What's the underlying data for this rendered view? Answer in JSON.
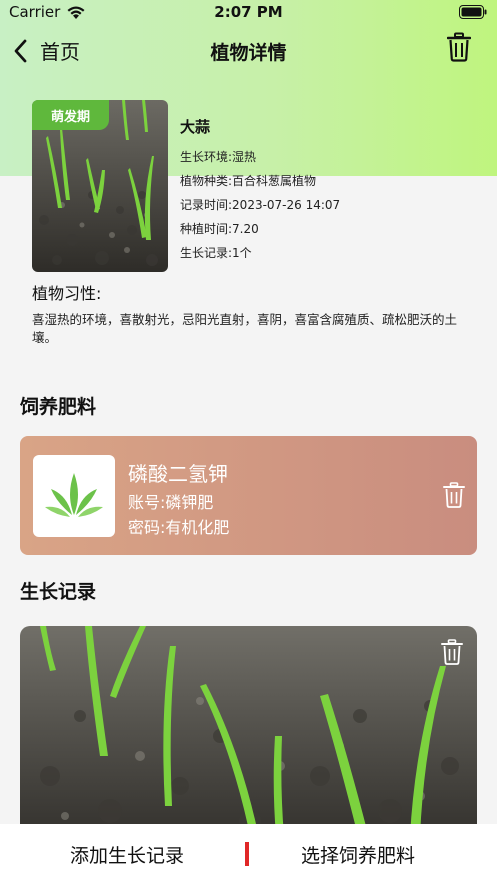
{
  "status_bar": {
    "carrier": "Carrier",
    "time": "2:07 PM"
  },
  "nav": {
    "back_label": "首页",
    "title": "植物详情"
  },
  "plant": {
    "stage": "萌发期",
    "name": "大蒜",
    "environment": "生长环境:湿热",
    "species": "植物种类:百合科葱属植物",
    "record_time": "记录时间:2023-07-26 14:07",
    "plant_time": "种植时间:7.20",
    "growth_count": "生长记录:1个",
    "habit_label": "植物习性:",
    "habit_text": "喜湿热的环境，喜散射光，忌阳光直射，喜阴，喜富含腐殖质、疏松肥沃的土壤。"
  },
  "fertilizer_section": {
    "title": "饲养肥料",
    "items": [
      {
        "name": "磷酸二氢钾",
        "account": "账号:磷钾肥",
        "password": "密码:有机化肥"
      }
    ]
  },
  "growth_section": {
    "title": "生长记录"
  },
  "bottom_bar": {
    "add_record": "添加生长记录",
    "select_fertilizer": "选择饲养肥料"
  },
  "colors": {
    "accent_green": "#5fb83c",
    "divider_red": "#e02727",
    "card_gradient_start": "#d9a486",
    "card_gradient_end": "#c98d7f"
  },
  "icons": {
    "back": "chevron-left-icon",
    "trash": "trash-icon",
    "wifi": "wifi-icon",
    "battery": "battery-icon",
    "leaf_logo": "leaf-logo-icon"
  }
}
